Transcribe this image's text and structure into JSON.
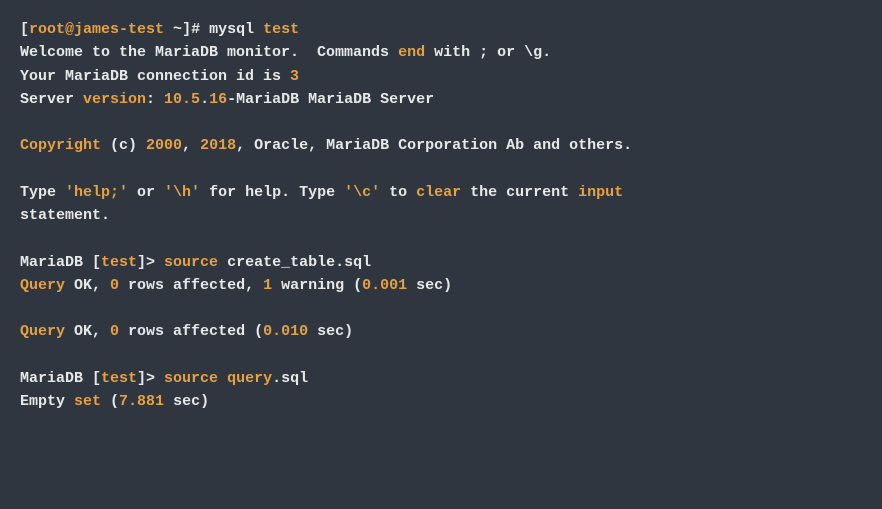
{
  "prompt1": {
    "bracket_open": "[",
    "user_host": "root@james-test",
    "path": " ~",
    "bracket_close": "]# ",
    "cmd": "mysql ",
    "arg": "test"
  },
  "welcome": {
    "l1_a": "Welcome to the MariaDB monitor.  Commands ",
    "l1_b": "end",
    "l1_c": " with ; or \\g.",
    "l2_a": "Your MariaDB connection id is ",
    "l2_b": "3",
    "l3_a": "Server ",
    "l3_b": "version",
    "l3_c": ": ",
    "l3_d": "10.5",
    "l3_e": ".",
    "l3_f": "16",
    "l3_g": "-MariaDB MariaDB Server"
  },
  "copyright": {
    "a": "Copyright",
    "b": " (c) ",
    "c": "2000",
    "d": ", ",
    "e": "2018",
    "f": ", Oracle, MariaDB Corporation Ab and others."
  },
  "help": {
    "a": "Type ",
    "b": "'help;'",
    "c": " or ",
    "d": "'\\h'",
    "e": " for help. Type ",
    "f": "'\\c'",
    "g": " to ",
    "h": "clear",
    "i": " the current ",
    "j": "input",
    "k": "statement."
  },
  "prompt2": {
    "a": "MariaDB [",
    "b": "test",
    "c": "]> ",
    "cmd": "source",
    "sp": " create_table.sql"
  },
  "q1": {
    "a": "Query",
    "b": " OK, ",
    "c": "0",
    "d": " rows affected, ",
    "e": "1",
    "f": " warning (",
    "g": "0.001",
    "h": " sec)"
  },
  "q2": {
    "a": "Query",
    "b": " OK, ",
    "c": "0",
    "d": " rows affected (",
    "e": "0.010",
    "f": " sec)"
  },
  "prompt3": {
    "a": "MariaDB [",
    "b": "test",
    "c": "]> ",
    "cmd": "source",
    "sp": " ",
    "file": "query",
    "ext": ".sql"
  },
  "empty": {
    "a": "Empty ",
    "b": "set",
    "c": " (",
    "d": "7.881",
    "e": " sec)"
  }
}
